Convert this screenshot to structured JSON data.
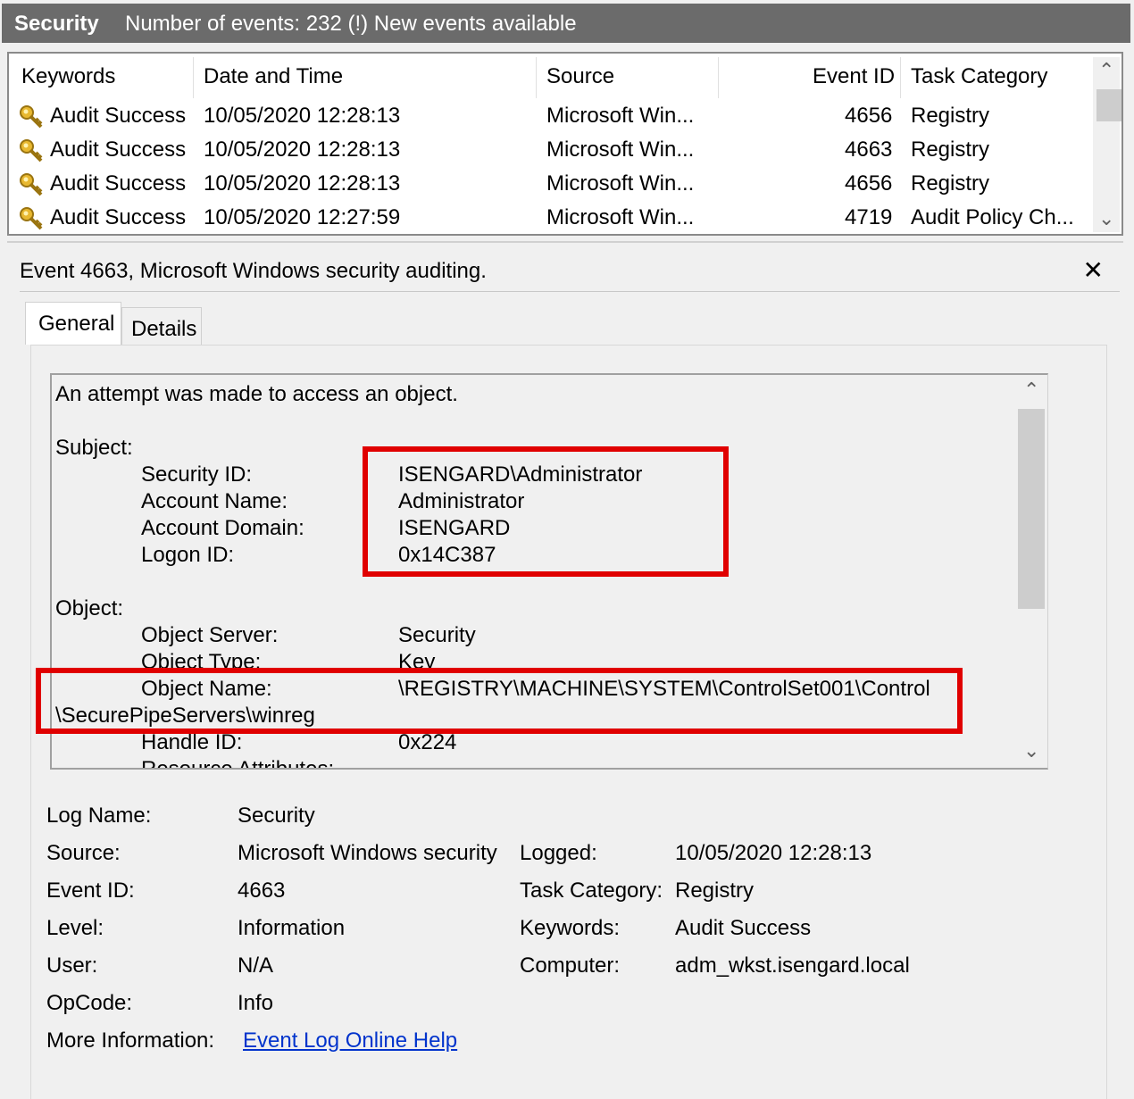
{
  "titlebar": {
    "log": "Security",
    "status": "Number of events: 232 (!) New events available"
  },
  "list": {
    "headers": [
      "Keywords",
      "Date and Time",
      "Source",
      "Event ID",
      "Task Category"
    ],
    "rows": [
      {
        "keywords": "Audit Success",
        "datetime": "10/05/2020 12:28:13",
        "source": "Microsoft Win...",
        "event_id": "4656",
        "task": "Registry"
      },
      {
        "keywords": "Audit Success",
        "datetime": "10/05/2020 12:28:13",
        "source": "Microsoft Win...",
        "event_id": "4663",
        "task": "Registry"
      },
      {
        "keywords": "Audit Success",
        "datetime": "10/05/2020 12:28:13",
        "source": "Microsoft Win...",
        "event_id": "4656",
        "task": "Registry"
      },
      {
        "keywords": "Audit Success",
        "datetime": "10/05/2020 12:27:59",
        "source": "Microsoft Win...",
        "event_id": "4719",
        "task": "Audit Policy Ch..."
      }
    ]
  },
  "detail": {
    "title": "Event 4663, Microsoft Windows security auditing.",
    "close": "✕",
    "tabs": [
      "General",
      "Details"
    ]
  },
  "event_text": {
    "intro": "An attempt was made to access an object.",
    "subject_label": "Subject:",
    "subject": [
      {
        "k": "Security ID:",
        "v": "ISENGARD\\Administrator"
      },
      {
        "k": "Account Name:",
        "v": "Administrator"
      },
      {
        "k": "Account Domain:",
        "v": "ISENGARD"
      },
      {
        "k": "Logon ID:",
        "v": "0x14C387"
      }
    ],
    "object_label": "Object:",
    "object": [
      {
        "k": "Object Server:",
        "v": "Security"
      },
      {
        "k": "Object Type:",
        "v": "Key"
      },
      {
        "k": "Object Name:",
        "v": "\\REGISTRY\\MACHINE\\SYSTEM\\ControlSet001\\Control"
      },
      {
        "k": "",
        "v": "\\SecurePipeServers\\winreg"
      },
      {
        "k": "Handle ID:",
        "v": "0x224"
      },
      {
        "k": "Resource Attributes:",
        "v": "-"
      }
    ]
  },
  "props": {
    "log_name_k": "Log Name:",
    "log_name_v": "Security",
    "source_k": "Source:",
    "source_v": "Microsoft Windows security",
    "logged_k": "Logged:",
    "logged_v": "10/05/2020 12:28:13",
    "event_id_k": "Event ID:",
    "event_id_v": "4663",
    "task_k": "Task Category:",
    "task_v": "Registry",
    "level_k": "Level:",
    "level_v": "Information",
    "keywords_k": "Keywords:",
    "keywords_v": "Audit Success",
    "user_k": "User:",
    "user_v": "N/A",
    "computer_k": "Computer:",
    "computer_v": "adm_wkst.isengard.local",
    "opcode_k": "OpCode:",
    "opcode_v": "Info",
    "more_k": "More Information:",
    "more_v": "Event Log Online Help"
  },
  "colors": {
    "highlight": "#e00000",
    "titlebar": "#6b6b6b",
    "link": "#0033cc"
  }
}
